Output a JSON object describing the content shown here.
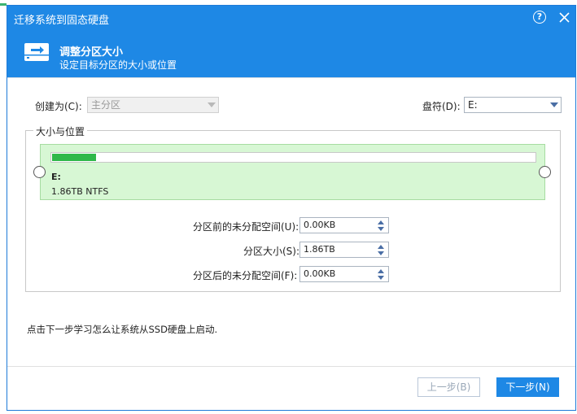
{
  "window": {
    "title": "迁移系统到固态硬盘"
  },
  "header": {
    "title": "调整分区大小",
    "subtitle": "设定目标分区的大小或位置"
  },
  "form": {
    "create_as_label": "创建为(C):",
    "create_as_value": "主分区",
    "drive_letter_label": "盘符(D):",
    "drive_letter_value": "E:"
  },
  "size_position": {
    "group_title": "大小与位置",
    "partition_label": "E:",
    "partition_info": "1.86TB NTFS",
    "used_fraction": 0.09,
    "fields": [
      {
        "label": "分区前的未分配空间(U):",
        "value": "0.00KB"
      },
      {
        "label": "分区大小(S):",
        "value": "1.86TB"
      },
      {
        "label": "分区后的未分配空间(F):",
        "value": "0.00KB"
      }
    ]
  },
  "hint": "点击下一步学习怎么让系统从SSD硬盘上启动.",
  "buttons": {
    "prev": "上一步(B)",
    "next": "下一步(N)"
  },
  "colors": {
    "accent": "#1e88e5",
    "partition_fill": "#d7f7d4",
    "bar_fill": "#2fb84a"
  }
}
